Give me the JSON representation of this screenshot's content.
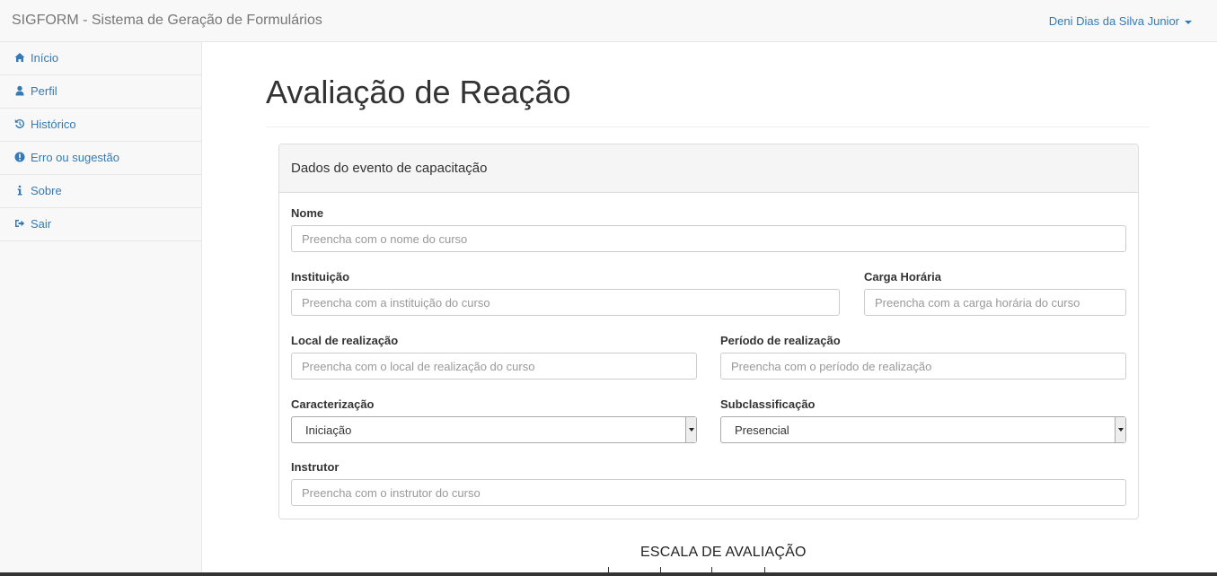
{
  "app": {
    "brand": "SIGFORM - Sistema de Geração de Formulários",
    "user": "Deni Dias da Silva Junior"
  },
  "sidebar": {
    "items": [
      {
        "label": "Início",
        "icon": "home-icon"
      },
      {
        "label": "Perfil",
        "icon": "user-icon"
      },
      {
        "label": "Histórico",
        "icon": "history-icon"
      },
      {
        "label": "Erro ou sugestão",
        "icon": "exclamation-circle-icon"
      },
      {
        "label": "Sobre",
        "icon": "info-icon"
      },
      {
        "label": "Sair",
        "icon": "sign-out-icon"
      }
    ]
  },
  "page": {
    "title": "Avaliação de Reação"
  },
  "panel": {
    "heading": "Dados do evento de capacitação",
    "fields": {
      "nome": {
        "label": "Nome",
        "placeholder": "Preencha com o nome do curso",
        "value": ""
      },
      "instituicao": {
        "label": "Instituição",
        "placeholder": "Preencha com a instituição do curso",
        "value": ""
      },
      "carga": {
        "label": "Carga Horária",
        "placeholder": "Preencha com a carga horária do curso",
        "value": ""
      },
      "local": {
        "label": "Local de realização",
        "placeholder": "Preencha com o local de realização do curso",
        "value": ""
      },
      "periodo": {
        "label": "Período de realização",
        "placeholder": "Preencha com o período de realização",
        "value": ""
      },
      "caracterizacao": {
        "label": "Caracterização",
        "selected": "Iniciação"
      },
      "subclassificacao": {
        "label": "Subclassificação",
        "selected": "Presencial"
      },
      "instrutor": {
        "label": "Instrutor",
        "placeholder": "Preencha com o instrutor do curso",
        "value": ""
      }
    }
  },
  "scale": {
    "title": "ESCALA DE AVALIAÇÃO"
  },
  "colors": {
    "link": "#337ab7",
    "navbar_bg": "#f8f8f8",
    "border": "#e7e7e7"
  }
}
